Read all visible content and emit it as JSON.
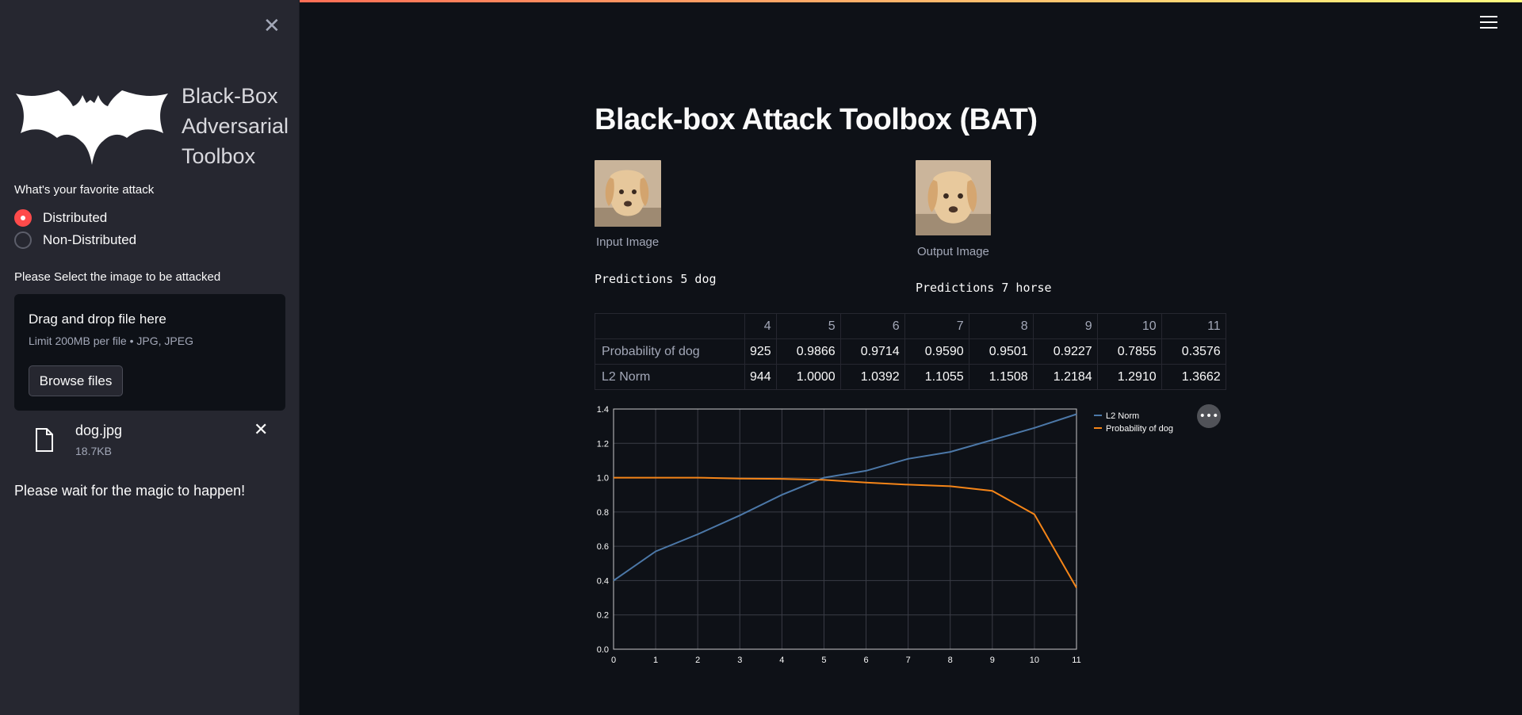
{
  "sidebar": {
    "logo_text": "Black-Box\nAdversarial\nToolbox",
    "logo_lines": [
      "Black-Box",
      "Adversarial",
      "Toolbox"
    ],
    "attack_question": "What's your favorite attack",
    "attack_options": [
      {
        "label": "Distributed",
        "selected": true
      },
      {
        "label": "Non-Distributed",
        "selected": false
      }
    ],
    "select_label": "Please Select the image to be attacked",
    "uploader": {
      "drag_text": "Drag and drop file here",
      "limit_text": "Limit 200MB per file • JPG, JPEG",
      "browse_label": "Browse files"
    },
    "file": {
      "name": "dog.jpg",
      "size": "18.7KB"
    },
    "status": "Please wait for the magic to happen!"
  },
  "main": {
    "title": "Black-box Attack Toolbox (BAT)",
    "input_caption": "Input Image",
    "output_caption": "Output Image",
    "input_prediction": "Predictions 5 dog",
    "output_prediction": "Predictions 7 horse",
    "table": {
      "columns": [
        "4",
        "5",
        "6",
        "7",
        "8",
        "9",
        "10",
        "11"
      ],
      "rows": [
        {
          "label": "Probability of dog",
          "values": [
            "925",
            "0.9866",
            "0.9714",
            "0.9590",
            "0.9501",
            "0.9227",
            "0.7855",
            "0.3576"
          ]
        },
        {
          "label": "L2 Norm",
          "values": [
            "944",
            "1.0000",
            "1.0392",
            "1.1055",
            "1.1508",
            "1.2184",
            "1.2910",
            "1.3662"
          ]
        }
      ]
    }
  },
  "colors": {
    "accent": "#ff4b4b",
    "l2": "#4c78a8",
    "prob": "#f58518"
  },
  "chart_data": {
    "type": "line",
    "x": [
      0,
      1,
      2,
      3,
      4,
      5,
      6,
      7,
      8,
      9,
      10,
      11
    ],
    "series": [
      {
        "name": "L2 Norm",
        "color": "#4c78a8",
        "values": [
          0.4,
          0.57,
          0.67,
          0.78,
          0.9,
          1.0,
          1.04,
          1.11,
          1.15,
          1.22,
          1.29,
          1.37
        ]
      },
      {
        "name": "Probability of dog",
        "color": "#f58518",
        "values": [
          1.0,
          1.0,
          1.0,
          0.995,
          0.993,
          0.987,
          0.971,
          0.959,
          0.95,
          0.923,
          0.786,
          0.358
        ]
      }
    ],
    "xticks": [
      "0",
      "1",
      "2",
      "3",
      "4",
      "5",
      "6",
      "7",
      "8",
      "9",
      "10",
      "11"
    ],
    "yticks": [
      "0.0",
      "0.2",
      "0.4",
      "0.6",
      "0.8",
      "1.0",
      "1.2",
      "1.4"
    ],
    "xlim": [
      0,
      11
    ],
    "ylim": [
      0,
      1.4
    ],
    "grid": true,
    "legend": "right"
  }
}
